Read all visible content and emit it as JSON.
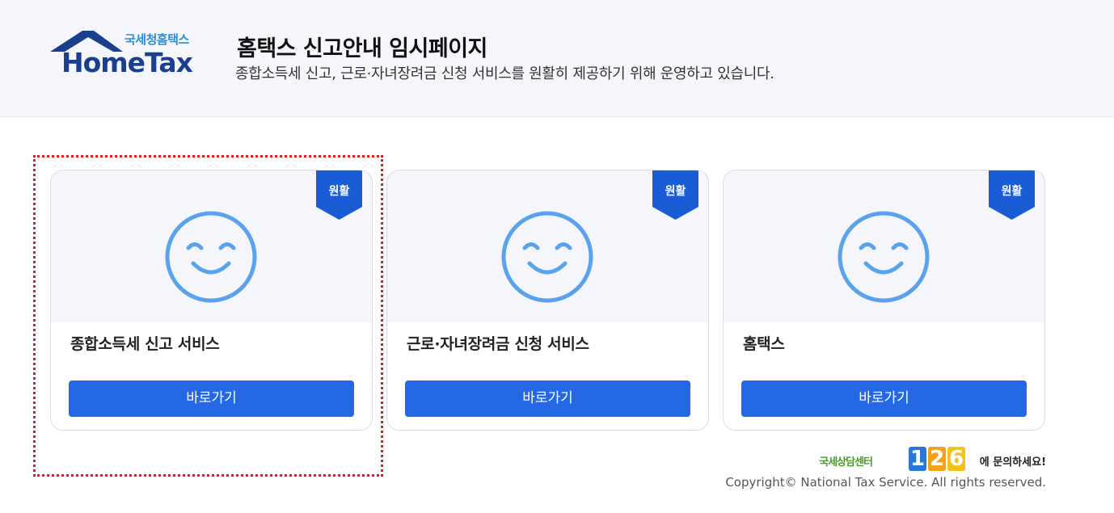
{
  "header": {
    "logo_small": "국세청홈택스",
    "logo_big": "HomeTax",
    "title": "홈택스 신고안내 임시페이지",
    "subtitle": "종합소득세 신고, 근로·자녀장려금 신청 서비스를 원활히 제공하기 위해 운영하고 있습니다."
  },
  "cards": [
    {
      "status": "원활",
      "title": "종합소득세 신고 서비스",
      "button": "바로가기",
      "icon": "smiley-face-icon"
    },
    {
      "status": "원활",
      "title": "근로·자녀장려금 신청 서비스",
      "button": "바로가기",
      "icon": "smiley-face-icon"
    },
    {
      "status": "원활",
      "title": "홈택스",
      "button": "바로가기",
      "icon": "smiley-face-icon"
    }
  ],
  "footer": {
    "contact_center": "국세상담센터",
    "contact_digits": [
      "1",
      "2",
      "6"
    ],
    "contact_suffix": "에 문의하세요!",
    "copyright": "Copyright© National Tax Service. All rights reserved."
  },
  "colors": {
    "accent": "#2468e5",
    "ribbon": "#1a5bd6",
    "smiley": "#5aa2ec",
    "header_bg": "#f4f6fb",
    "highlight": "#e01c1c"
  }
}
